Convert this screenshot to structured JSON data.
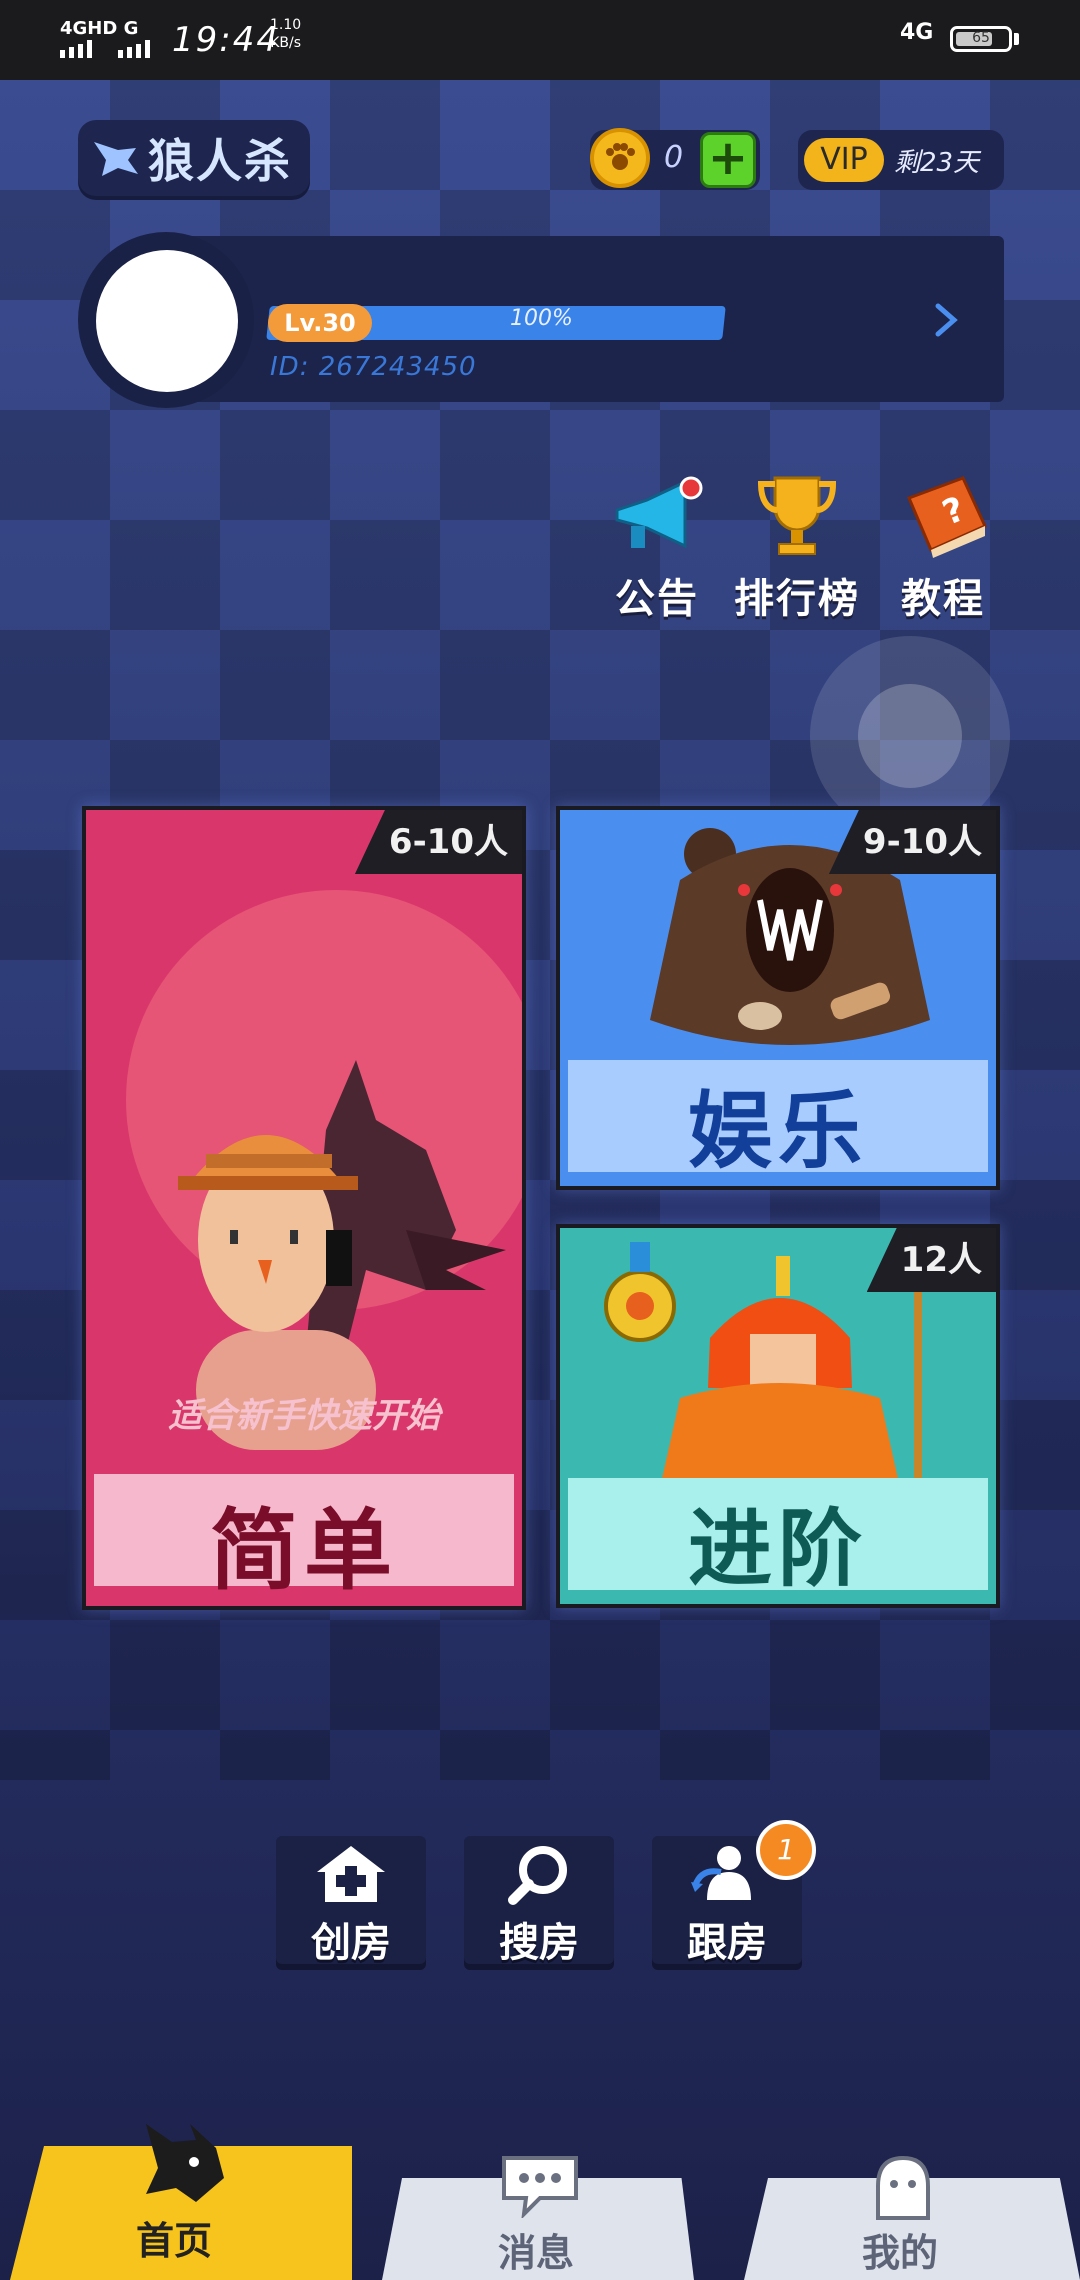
{
  "status_bar": {
    "network_left": "4GHD G",
    "time": "19:44",
    "speed_value": "1.10",
    "speed_unit": "KB/s",
    "network_right": "4G",
    "battery": "65"
  },
  "header": {
    "logo_text": "狼人杀",
    "coins": "0",
    "vip_label": "VIP",
    "vip_remaining": "剩23天"
  },
  "profile": {
    "level": "Lv.30",
    "progress_text": "100%",
    "progress": 1.0,
    "id_text": "ID: 267243450"
  },
  "quick_links": [
    {
      "label": "公告",
      "icon": "megaphone-icon"
    },
    {
      "label": "排行榜",
      "icon": "trophy-icon"
    },
    {
      "label": "教程",
      "icon": "question-book-icon"
    }
  ],
  "modes": {
    "easy": {
      "count": "6-10人",
      "subtitle": "适合新手快速开始",
      "title": "简单"
    },
    "fun": {
      "count": "9-10人",
      "title": "娱乐"
    },
    "advanced": {
      "count": "12人",
      "title": "进阶"
    }
  },
  "rooms": [
    {
      "label": "创房",
      "icon": "house-plus-icon"
    },
    {
      "label": "搜房",
      "icon": "magnifier-icon"
    },
    {
      "label": "跟房",
      "icon": "follow-user-icon"
    }
  ],
  "follow_badge": "1",
  "nav": {
    "home": "首页",
    "messages": "消息",
    "mine": "我的"
  },
  "colors": {
    "accent_yellow": "#f6c41c",
    "easy_card": "#d9376b",
    "fun_card": "#4a8ff0",
    "advanced_card": "#3bb8b0",
    "progress_blue": "#3a83e8"
  }
}
